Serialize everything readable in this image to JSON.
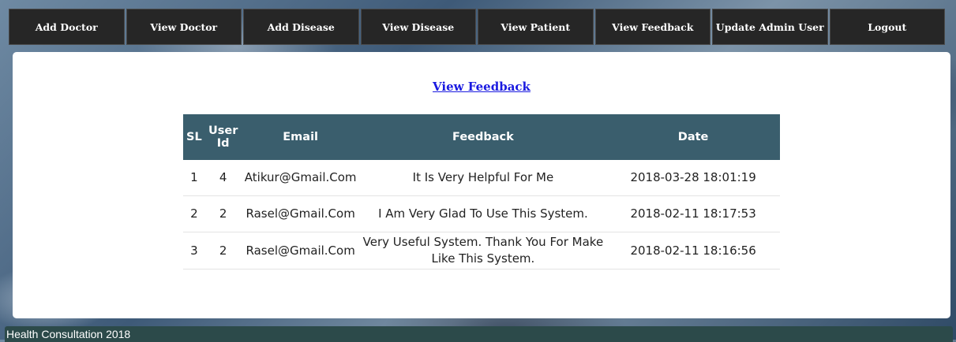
{
  "nav": {
    "items": [
      {
        "label": "Add Doctor"
      },
      {
        "label": "View Doctor"
      },
      {
        "label": "Add Disease"
      },
      {
        "label": "View Disease"
      },
      {
        "label": "View Patient"
      },
      {
        "label": "View Feedback"
      },
      {
        "label": "Update Admin User"
      },
      {
        "label": "Logout"
      }
    ]
  },
  "page": {
    "title": "View Feedback"
  },
  "table": {
    "headers": [
      "SL",
      "User Id",
      "Email",
      "Feedback",
      "Date"
    ],
    "rows": [
      [
        "1",
        "4",
        "Atikur@Gmail.Com",
        "It Is Very Helpful For Me",
        "2018-03-28 18:01:19"
      ],
      [
        "2",
        "2",
        "Rasel@Gmail.Com",
        "I Am Very Glad To Use This System.",
        "2018-02-11 18:17:53"
      ],
      [
        "3",
        "2",
        "Rasel@Gmail.Com",
        "Very Useful System. Thank You For Make Like This System.",
        "2018-02-11 18:16:56"
      ]
    ]
  },
  "footer": {
    "text": "Health Consultation 2018"
  }
}
